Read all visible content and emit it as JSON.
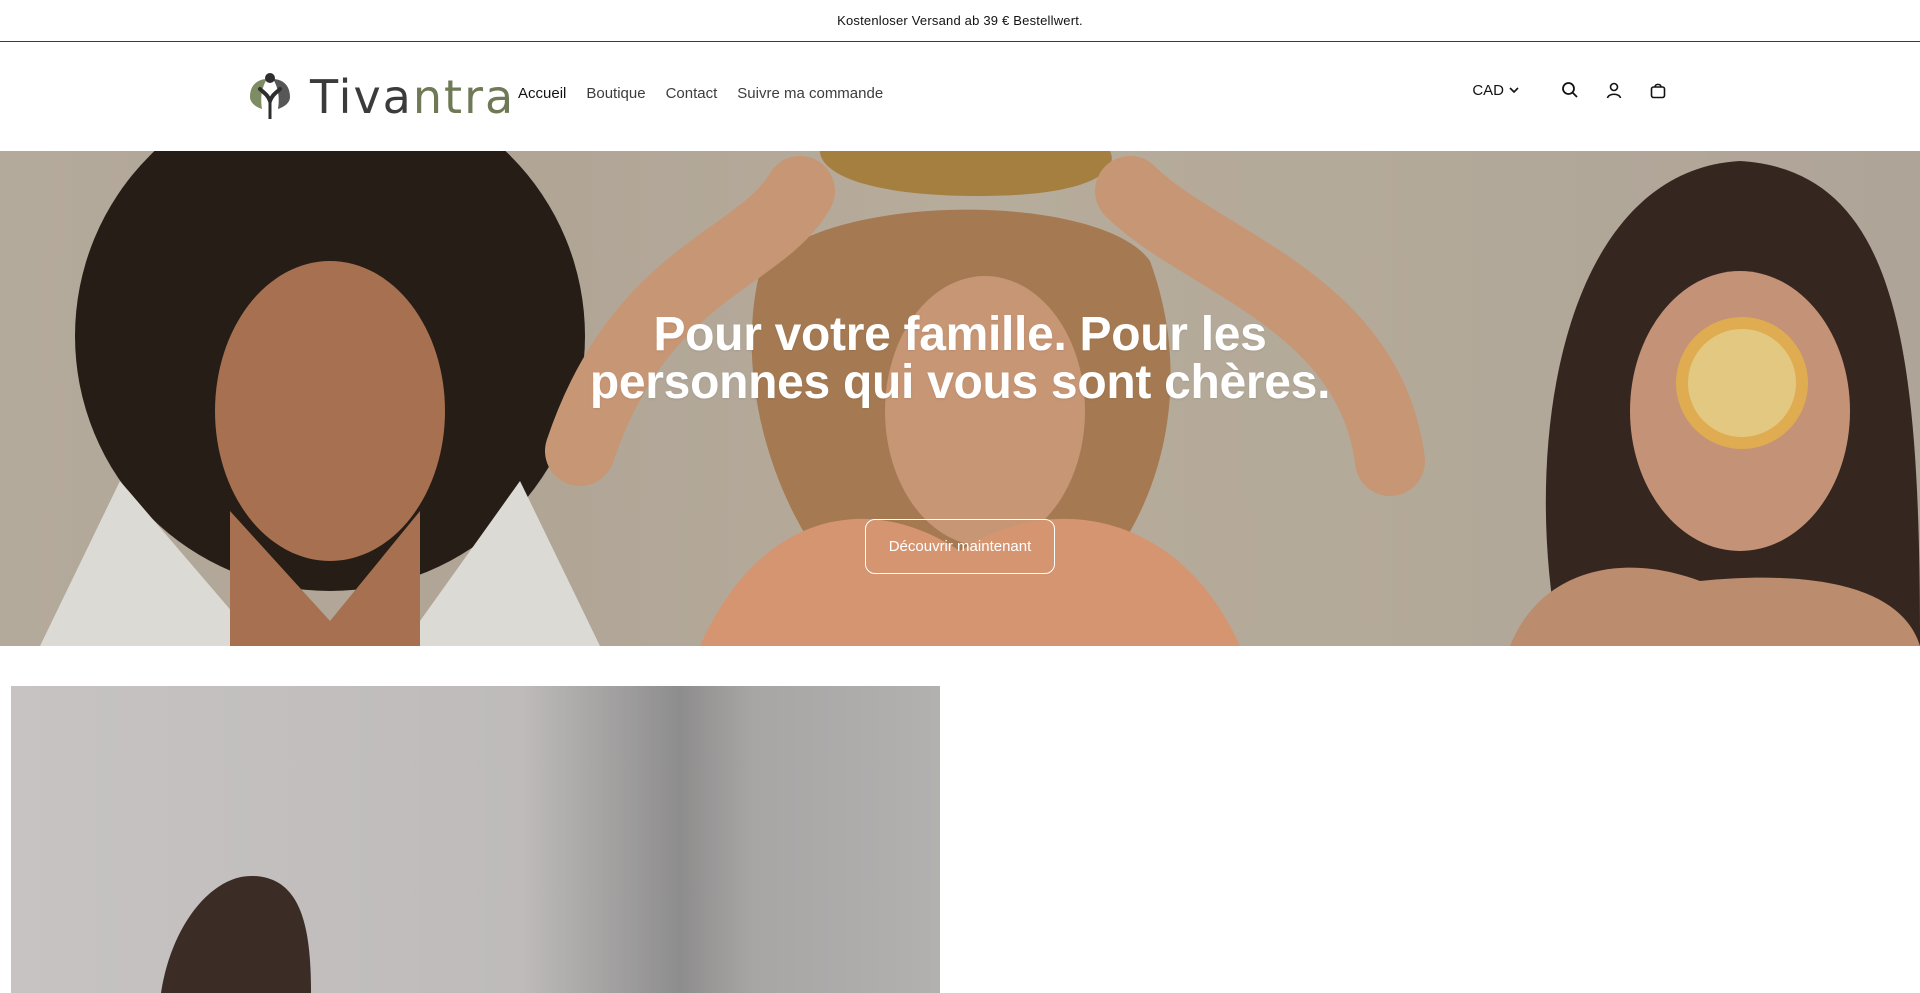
{
  "announcement": {
    "text": "Kostenloser Versand ab 39 € Bestellwert."
  },
  "header": {
    "logo": {
      "text_main": "Tiva",
      "text_accent": "ntra",
      "icon": "leaf-person-logo"
    },
    "nav": [
      {
        "label": "Accueil",
        "active": true
      },
      {
        "label": "Boutique",
        "active": false
      },
      {
        "label": "Contact",
        "active": false
      },
      {
        "label": "Suivre ma commande",
        "active": false
      }
    ],
    "currency": {
      "label": "CAD",
      "icon": "chevron-down-icon"
    },
    "icons": [
      "search-icon",
      "account-icon",
      "cart-icon"
    ]
  },
  "hero": {
    "title_line1": "Pour votre famille. Pour les",
    "title_line2": "personnes qui vous sont chères.",
    "button_label": "Découvrir maintenant"
  },
  "colors": {
    "text": "#121212",
    "logo_accent": "#6e7a55",
    "border": "#3a3a3a",
    "hero_text": "#ffffff"
  }
}
